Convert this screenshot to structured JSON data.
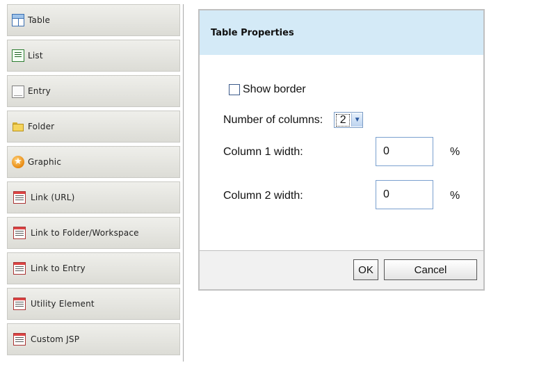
{
  "palette": {
    "items": [
      {
        "label": "Table",
        "icon": "table-icon"
      },
      {
        "label": "List",
        "icon": "list-icon"
      },
      {
        "label": "Entry",
        "icon": "entry-icon"
      },
      {
        "label": "Folder",
        "icon": "folder-icon"
      },
      {
        "label": "Graphic",
        "icon": "graphic-icon"
      },
      {
        "label": "Link (URL)",
        "icon": "link-url-icon"
      },
      {
        "label": "Link to Folder/Workspace",
        "icon": "link-folder-icon"
      },
      {
        "label": "Link to Entry",
        "icon": "link-entry-icon"
      },
      {
        "label": "Utility Element",
        "icon": "utility-element-icon"
      },
      {
        "label": "Custom JSP",
        "icon": "custom-jsp-icon"
      }
    ]
  },
  "dialog": {
    "title": "Table Properties",
    "show_border_label": "Show border",
    "show_border_checked": false,
    "columns_label": "Number of columns:",
    "columns_value": "2",
    "col1_label": "Column 1 width:",
    "col1_value": "0",
    "col2_label": "Column 2 width:",
    "col2_value": "0",
    "percent_symbol": "%",
    "ok_label": "OK",
    "cancel_label": "Cancel"
  },
  "colors": {
    "header_bg": "#d4eaf7",
    "palette_bg": "#e6e6e2",
    "footer_bg": "#f1f1f1"
  }
}
